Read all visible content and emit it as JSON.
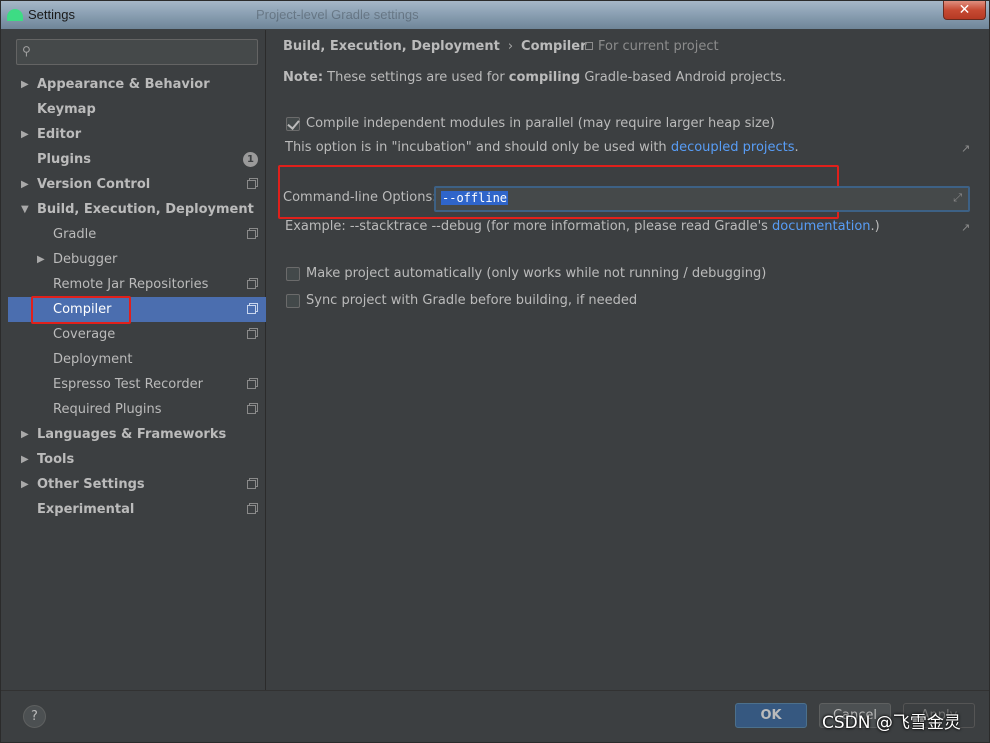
{
  "window": {
    "title": "Settings",
    "title_ghost": "Project-level Gradle settings",
    "close_glyph": "✕"
  },
  "search": {
    "placeholder": "",
    "icon": "search-icon"
  },
  "sidebar": {
    "items": [
      {
        "label": "Appearance & Behavior",
        "arrow": "▶",
        "bold": true
      },
      {
        "label": "Keymap",
        "arrow": "",
        "bold": true
      },
      {
        "label": "Editor",
        "arrow": "▶",
        "bold": true
      },
      {
        "label": "Plugins",
        "arrow": "",
        "bold": true,
        "badge": "1"
      },
      {
        "label": "Version Control",
        "arrow": "▶",
        "bold": true,
        "project": true
      },
      {
        "label": "Build, Execution, Deployment",
        "arrow": "▼",
        "bold": true
      },
      {
        "label": "Gradle",
        "arrow": "",
        "child": true,
        "project": true
      },
      {
        "label": "Debugger",
        "arrow": "▶",
        "child": true
      },
      {
        "label": "Remote Jar Repositories",
        "arrow": "",
        "child": true,
        "project": true
      },
      {
        "label": "Compiler",
        "arrow": "",
        "child": true,
        "project": true,
        "selected": true
      },
      {
        "label": "Coverage",
        "arrow": "",
        "child": true,
        "project": true
      },
      {
        "label": "Deployment",
        "arrow": "",
        "child": true
      },
      {
        "label": "Espresso Test Recorder",
        "arrow": "",
        "child": true,
        "project": true
      },
      {
        "label": "Required Plugins",
        "arrow": "",
        "child": true,
        "project": true
      },
      {
        "label": "Languages & Frameworks",
        "arrow": "▶",
        "bold": true
      },
      {
        "label": "Tools",
        "arrow": "▶",
        "bold": true
      },
      {
        "label": "Other Settings",
        "arrow": "▶",
        "bold": true,
        "project": true
      },
      {
        "label": "Experimental",
        "arrow": "",
        "bold": true,
        "project": true
      }
    ]
  },
  "breadcrumb": {
    "parent": "Build, Execution, Deployment",
    "separator": "›",
    "current": "Compiler",
    "scope": "For current project"
  },
  "note": {
    "prefix": "Note:",
    "text1": " These settings are used for ",
    "bold": "compiling",
    "text2": " Gradle-based Android projects."
  },
  "options": {
    "parallel_label": "Compile independent modules in parallel (may require larger heap size)",
    "parallel_checked": true,
    "incubation_text": "This option is in \"incubation\" and should only be used with ",
    "incubation_link": "decoupled projects",
    "incubation_end": ".",
    "cmd_label": "Command-line Options:",
    "cmd_value": "--offline",
    "example_text": "Example: --stacktrace --debug (for more information, please read Gradle's ",
    "example_link": "documentation",
    "example_end": ".)",
    "make_auto_label": "Make project automatically (only works while not running / debugging)",
    "make_auto_checked": false,
    "sync_label": "Sync project with Gradle before building, if needed",
    "sync_checked": false
  },
  "footer": {
    "help": "?",
    "ok": "OK",
    "cancel": "Cancel",
    "apply": "Apply"
  },
  "watermark": "CSDN @飞雪金灵",
  "colors": {
    "background": "#3c3f41",
    "selection": "#4b6eaf",
    "link": "#589df6",
    "highlight_box": "#e0201b",
    "ok_button": "#365880"
  }
}
